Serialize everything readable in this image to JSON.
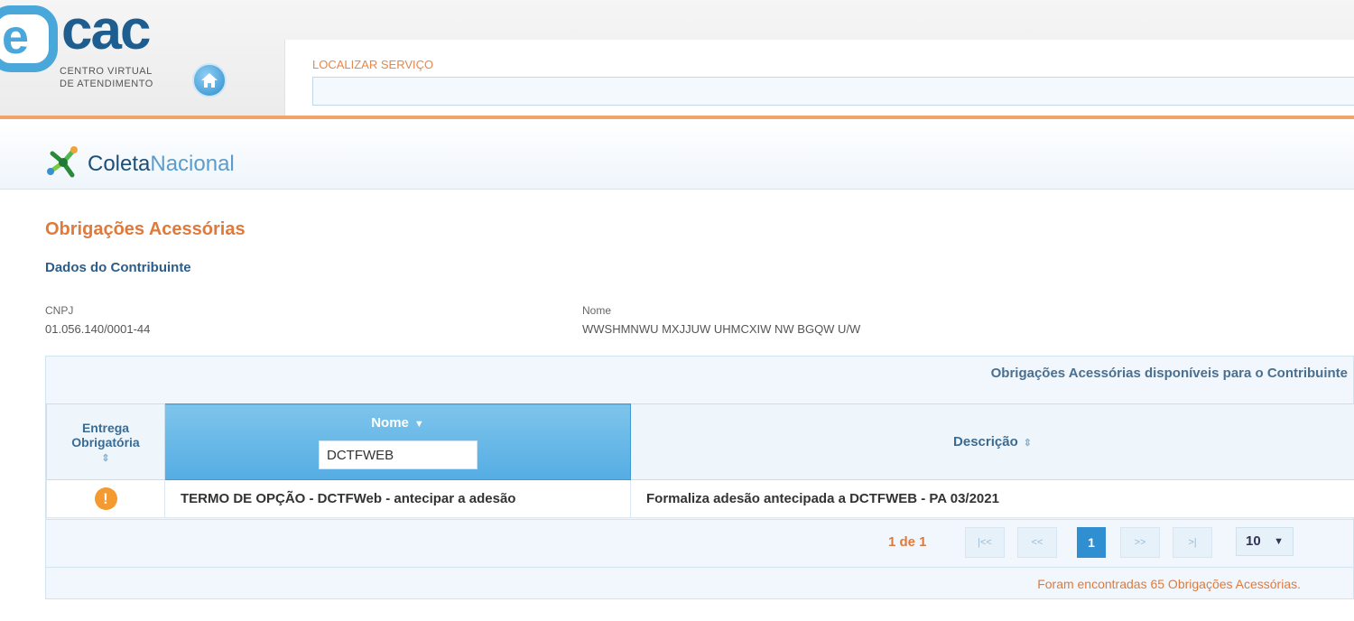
{
  "header": {
    "logo_word": "cac",
    "logo_letter": "e",
    "logo_sub_line1": "CENTRO VIRTUAL",
    "logo_sub_line2": "DE ATENDIMENTO",
    "search_label": "LOCALIZAR SERVIÇO",
    "search_value": ""
  },
  "coleta": {
    "brand_part1": "Coleta",
    "brand_part2": "Nacional"
  },
  "page": {
    "title": "Obrigações Acessórias",
    "section_title": "Dados do Contribuinte"
  },
  "contribuinte": {
    "cnpj_label": "CNPJ",
    "cnpj_value": "01.056.140/0001-44",
    "nome_label": "Nome",
    "nome_value": "WWSHMNWU MXJJUW UHMCXIW NW BGQW U/W"
  },
  "table": {
    "caption": "Obrigações Acessórias disponíveis para o Contribuinte",
    "columns": {
      "entrega_line1": "Entrega",
      "entrega_line2": "Obrigatória",
      "nome": "Nome",
      "descricao": "Descrição"
    },
    "filter_value": "DCTFWEB",
    "rows": [
      {
        "nome": "TERMO DE OPÇÃO - DCTFWeb - antecipar a adesão",
        "descricao": "Formaliza adesão antecipada a DCTFWEB - PA 03/2021",
        "alert_icon": "!"
      }
    ]
  },
  "pagination": {
    "page_info": "1 de 1",
    "first": "|<<",
    "prev": "<<",
    "current": "1",
    "next": ">>",
    "last": ">|",
    "per_page": "10"
  },
  "footer": {
    "found_text": "Foram encontradas 65 Obrigações Acessórias."
  },
  "colors": {
    "accent_orange": "#e07a3c",
    "brand_blue": "#1d5d8f",
    "active_blue": "#2f8fd0"
  }
}
